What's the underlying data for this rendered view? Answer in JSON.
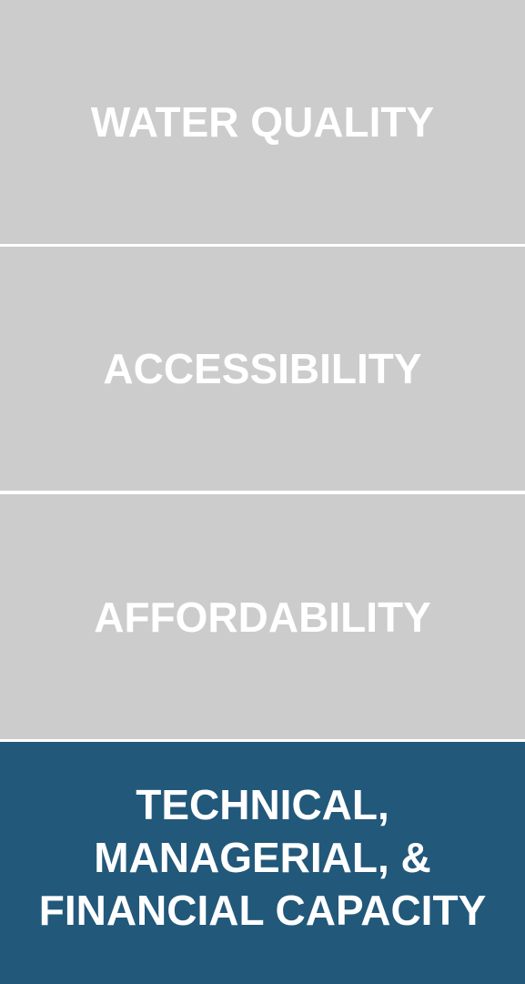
{
  "pillars": [
    {
      "label": "WATER QUALITY",
      "color": "#cccccc",
      "highlighted": false
    },
    {
      "label": "ACCESSIBILITY",
      "color": "#cccccc",
      "highlighted": false
    },
    {
      "label": "AFFORDABILITY",
      "color": "#cccccc",
      "highlighted": false
    },
    {
      "label": "TECHNICAL,\nMANAGERIAL, &\nFINANCIAL CAPACITY",
      "color": "#22587a",
      "highlighted": true
    }
  ],
  "colors": {
    "inactive": "#cccccc",
    "active": "#22587a",
    "text": "#ffffff",
    "divider": "#ffffff"
  }
}
